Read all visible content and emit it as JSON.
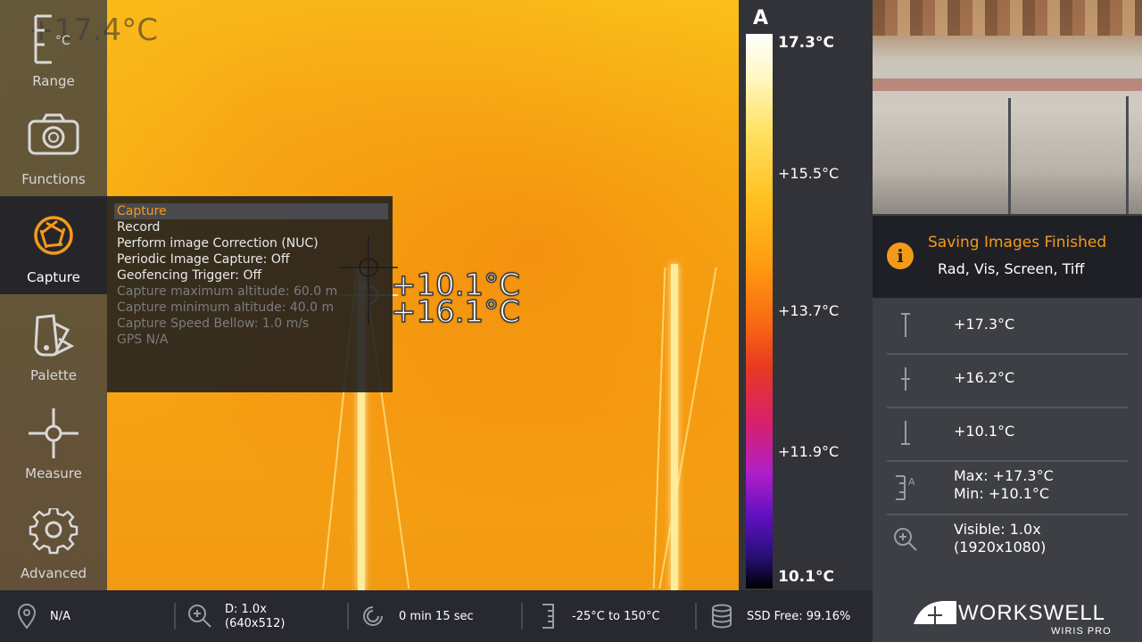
{
  "sidebar": {
    "items": [
      {
        "label": "Range",
        "icon": "range-icon"
      },
      {
        "label": "Functions",
        "icon": "camera-icon"
      },
      {
        "label": "Capture",
        "icon": "aperture-icon"
      },
      {
        "label": "Palette",
        "icon": "palette-icon"
      },
      {
        "label": "Measure",
        "icon": "crosshair-icon"
      },
      {
        "label": "Advanced",
        "icon": "gear-icon"
      }
    ],
    "active": "Capture"
  },
  "range_overlay": {
    "unit": "°C",
    "temp": "+17.4°C"
  },
  "capture_menu": {
    "items": [
      {
        "label": "Capture",
        "state": "selected"
      },
      {
        "label": "Record",
        "state": "enabled"
      },
      {
        "label": "Perform image Correction (NUC)",
        "state": "enabled"
      },
      {
        "label": "Periodic Image Capture: Off",
        "state": "enabled"
      },
      {
        "label": "Geofencing Trigger: Off",
        "state": "enabled"
      },
      {
        "label": "Capture maximum altitude: 60.0 m",
        "state": "disabled"
      },
      {
        "label": "Capture minimum altitude: 40.0 m",
        "state": "disabled"
      },
      {
        "label": "Capture Speed Bellow: 1.0 m/s",
        "state": "disabled"
      },
      {
        "label": "GPS N/A",
        "state": "disabled"
      }
    ]
  },
  "measure_overlay": {
    "spot1": "+10.1°C",
    "spot2": "+16.1°C"
  },
  "color_scale": {
    "mode": "A",
    "labels": [
      "17.3°C",
      "+15.5°C",
      "+13.7°C",
      "+11.9°C",
      "10.1°C"
    ],
    "colors": {
      "accent": "#f49a1a"
    }
  },
  "notification": {
    "title": "Saving Images Finished",
    "body": "Rad, Vis, Screen, Tiff",
    "icon": "info-icon"
  },
  "measurements": [
    {
      "icon": "max-marker-icon",
      "line1": "+17.3°C",
      "line2": ""
    },
    {
      "icon": "center-marker-icon",
      "line1": "+16.2°C",
      "line2": ""
    },
    {
      "icon": "min-marker-icon",
      "line1": "+10.1°C",
      "line2": ""
    },
    {
      "icon": "range-auto-icon",
      "line1": "Max: +17.3°C",
      "line2": "Min: +10.1°C"
    },
    {
      "icon": "zoom-icon",
      "line1": "Visible: 1.0x",
      "line2": "(1920x1080)"
    }
  ],
  "logo": {
    "word": "WORKSWELL",
    "sub": "WIRIS PRO"
  },
  "status_bar": {
    "gps": "N/A",
    "zoom_line1": "D: 1.0x",
    "zoom_line2": "(640x512)",
    "timer": "0 min 15 sec",
    "range": "-25°C to 150°C",
    "storage": "SSD Free: 99.16%"
  }
}
